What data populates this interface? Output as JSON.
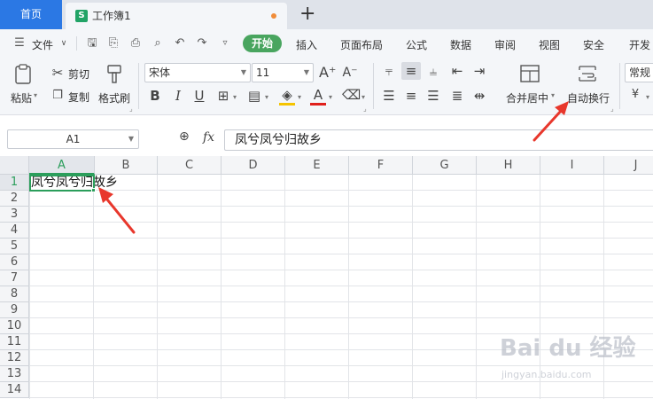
{
  "tabbar": {
    "home_label": "首页",
    "doc_icon": "S",
    "doc_title": "工作簿1",
    "new_tab": "+"
  },
  "menu": {
    "file_label": "文件",
    "start_label": "开始",
    "items": [
      "插入",
      "页面布局",
      "公式",
      "数据",
      "审阅",
      "视图",
      "安全",
      "开发"
    ]
  },
  "ribbon": {
    "paste_label": "粘贴",
    "cut_label": "剪切",
    "copy_label": "复制",
    "format_painter_label": "格式刷",
    "font_name": "宋体",
    "font_size": "11",
    "bold": "B",
    "italic": "I",
    "underline": "U",
    "font_color_letter": "A",
    "merge_label": "合并居中",
    "wrap_label": "自动换行",
    "number_format": "常规",
    "currency_symbol": "¥"
  },
  "formula_bar": {
    "cell_ref": "A1",
    "fx": "fx",
    "content": "凤兮凤兮归故乡"
  },
  "grid": {
    "columns": [
      "A",
      "B",
      "C",
      "D",
      "E",
      "F",
      "G",
      "H",
      "I",
      "J"
    ],
    "rows": [
      "1",
      "2",
      "3",
      "4",
      "5",
      "6",
      "7",
      "8",
      "9",
      "10",
      "11",
      "12",
      "13",
      "14"
    ],
    "a1_text": "凤兮凤兮归故乡"
  },
  "watermark": {
    "brand": "Bai du 经验",
    "url": "jingyan.baidu.com"
  },
  "colors": {
    "accent_green": "#2b9e5b",
    "tab_blue": "#2b78e4",
    "arrow_red": "#e8372c"
  }
}
